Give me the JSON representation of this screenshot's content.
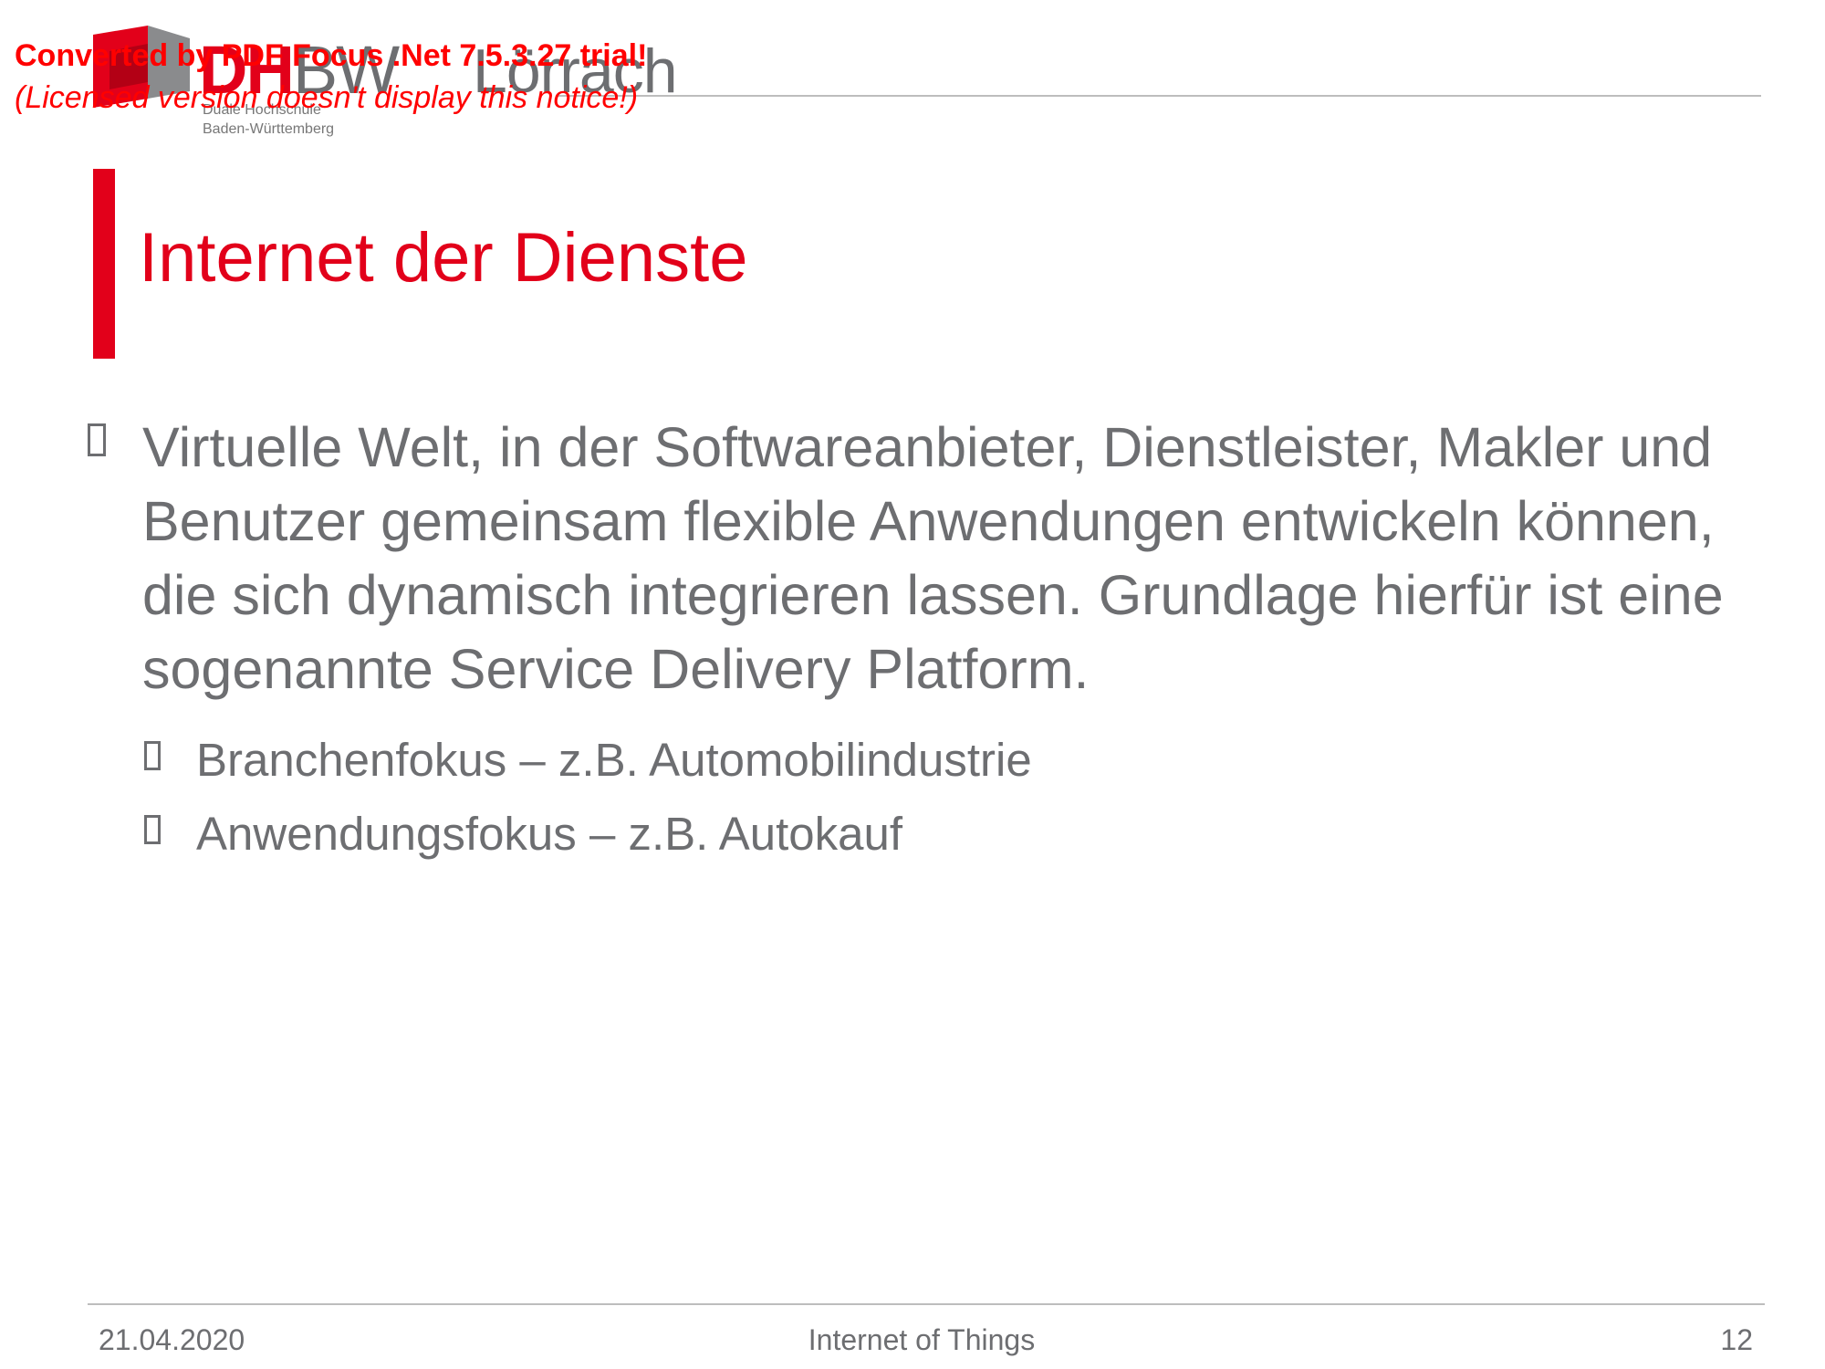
{
  "watermark": {
    "line1": "Converted by PDF Focus .Net 7.5.3.27 trial!",
    "line2": "(Licensed version doesn't display this notice!)"
  },
  "logo": {
    "brand_dh": "DH",
    "brand_bw": "BW",
    "campus": "Lörrach",
    "subtitle_line1": "Duale Hochschule",
    "subtitle_line2": "Baden-Württemberg"
  },
  "slide": {
    "title": "Internet der Dienste",
    "main_bullet": "Virtuelle Welt, in der Softwareanbieter, Dienstleister, Makler und Benutzer gemeinsam flexible Anwendungen entwickeln können, die sich dynamisch integrieren lassen. Grundlage hierfür ist eine sogenannte Service Delivery Platform.",
    "sub_bullets": [
      "Branchenfokus – z.B. Automobilindustrie",
      "Anwendungsfokus – z.B. Autokauf"
    ]
  },
  "footer": {
    "date": "21.04.2020",
    "title": "Internet of Things",
    "page": "12"
  },
  "colors": {
    "accent": "#e2001a",
    "text": "#6d6e71",
    "watermark": "#ff0000"
  }
}
